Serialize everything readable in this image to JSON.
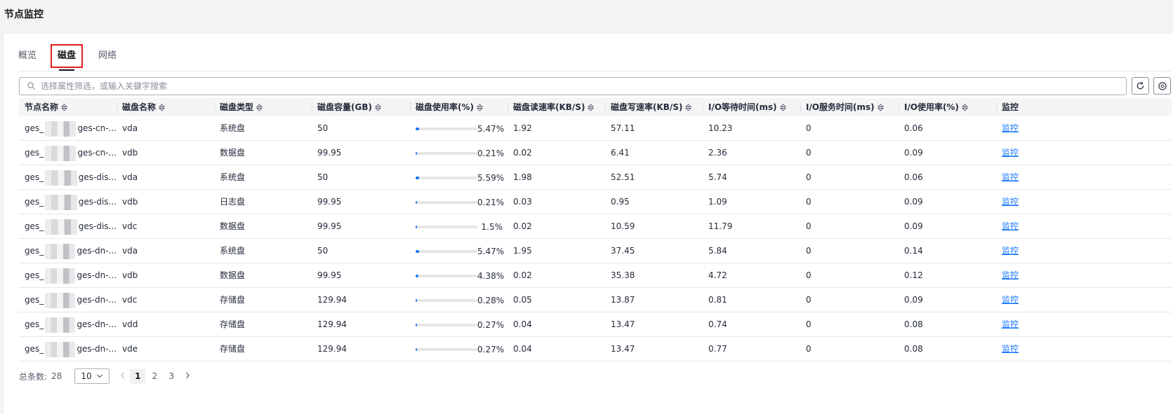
{
  "page": {
    "title": "节点监控"
  },
  "tabs": [
    {
      "label": "概览"
    },
    {
      "label": "磁盘"
    },
    {
      "label": "网络"
    }
  ],
  "search": {
    "placeholder": "选择属性筛选，或输入关键字搜索"
  },
  "toolbar": {
    "refresh_icon": "refresh-icon",
    "settings_icon": "gear-icon"
  },
  "table": {
    "columns": [
      "节点名称",
      "磁盘名称",
      "磁盘类型",
      "磁盘容量(GB)",
      "磁盘使用率(%)",
      "磁盘读速率(KB/S)",
      "磁盘写速率(KB/S)",
      "I/O等待时间(ms)",
      "I/O服务时间(ms)",
      "I/O使用率(%)",
      "监控"
    ],
    "rows": [
      {
        "node_prefix": "ges_",
        "node_suffix": "ges-cn-...",
        "disk": "vda",
        "type": "系统盘",
        "capacity": "50",
        "usage_pct": "5.47%",
        "usage_value": 5.47,
        "read": "1.92",
        "write": "57.11",
        "io_wait": "10.23",
        "io_service": "0",
        "io_usage": "0.06",
        "action": "监控"
      },
      {
        "node_prefix": "ges_",
        "node_suffix": "ges-cn-...",
        "disk": "vdb",
        "type": "数据盘",
        "capacity": "99.95",
        "usage_pct": "0.21%",
        "usage_value": 0.21,
        "read": "0.02",
        "write": "6.41",
        "io_wait": "2.36",
        "io_service": "0",
        "io_usage": "0.09",
        "action": "监控"
      },
      {
        "node_prefix": "ges_",
        "node_suffix": "ges-dis...",
        "disk": "vda",
        "type": "系统盘",
        "capacity": "50",
        "usage_pct": "5.59%",
        "usage_value": 5.59,
        "read": "1.98",
        "write": "52.51",
        "io_wait": "5.74",
        "io_service": "0",
        "io_usage": "0.06",
        "action": "监控"
      },
      {
        "node_prefix": "ges_",
        "node_suffix": "ges-dis...",
        "disk": "vdb",
        "type": "日志盘",
        "capacity": "99.95",
        "usage_pct": "0.21%",
        "usage_value": 0.21,
        "read": "0.03",
        "write": "0.95",
        "io_wait": "1.09",
        "io_service": "0",
        "io_usage": "0.09",
        "action": "监控"
      },
      {
        "node_prefix": "ges_",
        "node_suffix": "ges-dis...",
        "disk": "vdc",
        "type": "数据盘",
        "capacity": "99.95",
        "usage_pct": "1.5%",
        "usage_value": 1.5,
        "read": "0.02",
        "write": "10.59",
        "io_wait": "11.79",
        "io_service": "0",
        "io_usage": "0.09",
        "action": "监控"
      },
      {
        "node_prefix": "ges_",
        "node_suffix": "ges-dn-...",
        "disk": "vda",
        "type": "系统盘",
        "capacity": "50",
        "usage_pct": "5.47%",
        "usage_value": 5.47,
        "read": "1.95",
        "write": "37.45",
        "io_wait": "5.84",
        "io_service": "0",
        "io_usage": "0.14",
        "action": "监控"
      },
      {
        "node_prefix": "ges_",
        "node_suffix": "ges-dn-...",
        "disk": "vdb",
        "type": "数据盘",
        "capacity": "99.95",
        "usage_pct": "4.38%",
        "usage_value": 4.38,
        "read": "0.02",
        "write": "35.38",
        "io_wait": "4.72",
        "io_service": "0",
        "io_usage": "0.12",
        "action": "监控"
      },
      {
        "node_prefix": "ges_",
        "node_suffix": "ges-dn-...",
        "disk": "vdc",
        "type": "存储盘",
        "capacity": "129.94",
        "usage_pct": "0.28%",
        "usage_value": 0.28,
        "read": "0.05",
        "write": "13.87",
        "io_wait": "0.81",
        "io_service": "0",
        "io_usage": "0.09",
        "action": "监控"
      },
      {
        "node_prefix": "ges_",
        "node_suffix": "ges-dn-...",
        "disk": "vdd",
        "type": "存储盘",
        "capacity": "129.94",
        "usage_pct": "0.27%",
        "usage_value": 0.27,
        "read": "0.04",
        "write": "13.47",
        "io_wait": "0.74",
        "io_service": "0",
        "io_usage": "0.08",
        "action": "监控"
      },
      {
        "node_prefix": "ges_",
        "node_suffix": "ges-dn-...",
        "disk": "vde",
        "type": "存储盘",
        "capacity": "129.94",
        "usage_pct": "0.27%",
        "usage_value": 0.27,
        "read": "0.04",
        "write": "13.47",
        "io_wait": "0.77",
        "io_service": "0",
        "io_usage": "0.08",
        "action": "监控"
      }
    ]
  },
  "pagination": {
    "total_label": "总条数:",
    "total": "28",
    "page_size": "10",
    "pages": [
      "1",
      "2",
      "3"
    ],
    "current": "1"
  },
  "colors": {
    "accent": "#1476ff",
    "active_tab_border": "#e11e1e"
  }
}
